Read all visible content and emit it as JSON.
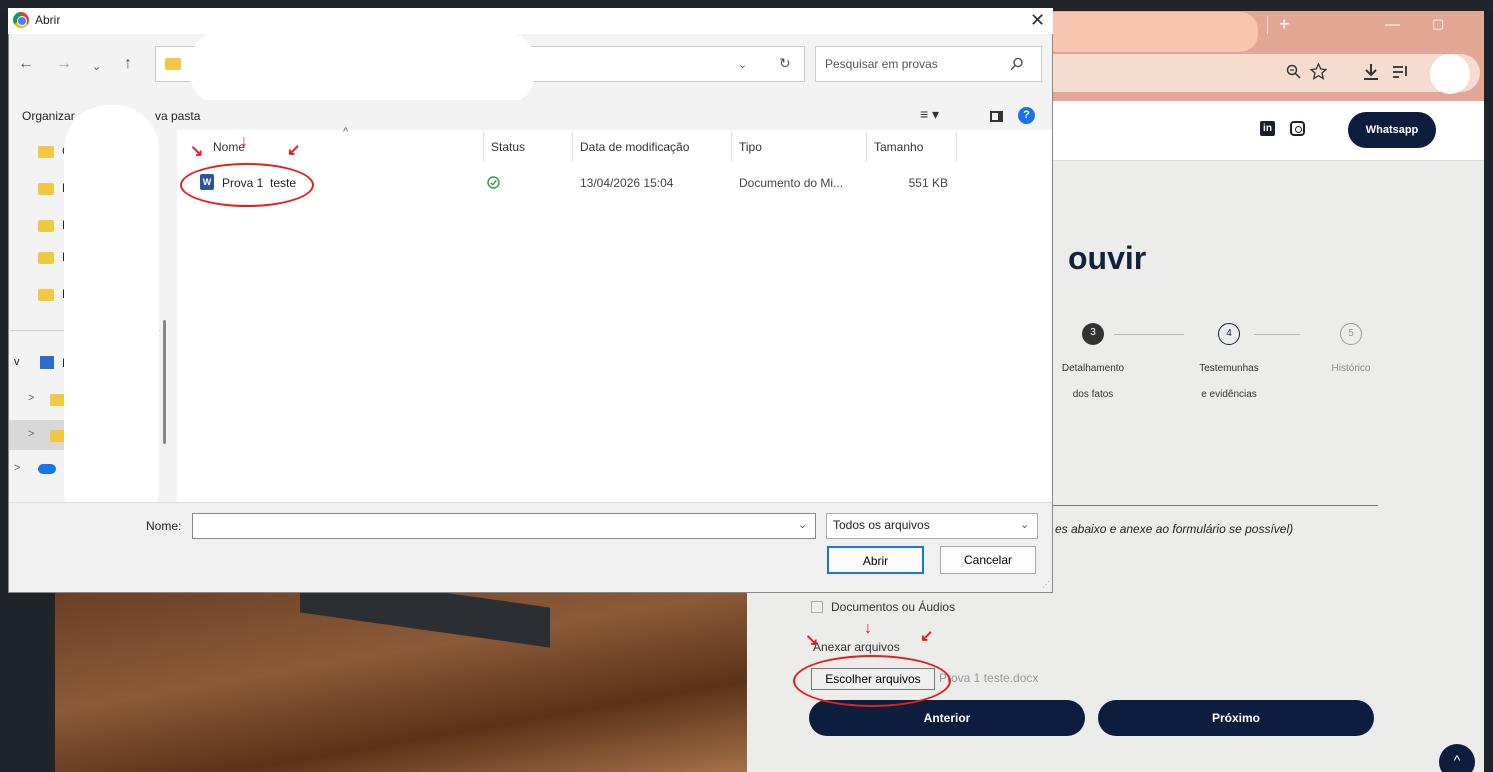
{
  "browser": {
    "new_tab_symbol": "+",
    "minimize_symbol": "—",
    "restore_symbol": "▢",
    "toolbar_icons": [
      "zoom-icon",
      "star-icon",
      "download-icon",
      "playlist-icon"
    ]
  },
  "site": {
    "whatsapp_label": "Whatsapp",
    "linkedin_label": "in",
    "heading": "ouvir",
    "steps": [
      {
        "number": "3",
        "label_line1": "Detalhamento",
        "label_line2": "dos fatos",
        "state": "active"
      },
      {
        "number": "4",
        "label_line1": "Testemunhas",
        "label_line2": "e evidências",
        "state": "current"
      },
      {
        "number": "5",
        "label_line1": "Histórico",
        "label_line2": "",
        "state": "pending"
      }
    ],
    "hint_text": "es abaixo e anexe ao formulário se possível)",
    "documents_label": "Documentos ou Áudios",
    "attach_label": "Anexar arquivos",
    "choose_files_label": "Escolher arquivos",
    "chosen_file": "Prova 1 teste.docx",
    "prev_label": "Anterior",
    "next_label": "Próximo",
    "scroll_top_symbol": "^"
  },
  "dialog": {
    "title": "Abrir",
    "close_symbol": "✕",
    "search_placeholder": "Pesquisar em provas",
    "organize_label": "Organizar",
    "new_folder_label": "va pasta",
    "sidebar_items": [
      "C",
      "D",
      "R",
      "H",
      "P"
    ],
    "tree_items": [
      {
        "chevron": "v",
        "initial": "N"
      },
      {
        "chevron": ">",
        "initial": ""
      },
      {
        "chevron": ">",
        "initial": ""
      },
      {
        "chevron": ">",
        "initial": ""
      }
    ],
    "columns": [
      "Nome",
      "Status",
      "Data de modificação",
      "Tipo",
      "Tamanho"
    ],
    "files": [
      {
        "name": "Prova 1  teste",
        "status": "synced",
        "date": "13/04/2026 15:04",
        "type": "Documento do Mi...",
        "size": "551 KB"
      }
    ],
    "name_label": "Nome:",
    "name_value": "",
    "filter_value": "Todos os arquivos",
    "open_label": "Abrir",
    "cancel_label": "Cancelar"
  },
  "colors": {
    "navy": "#0c1d3e",
    "annotation_red": "#e02020",
    "chrome_peach": "#e2a895"
  }
}
